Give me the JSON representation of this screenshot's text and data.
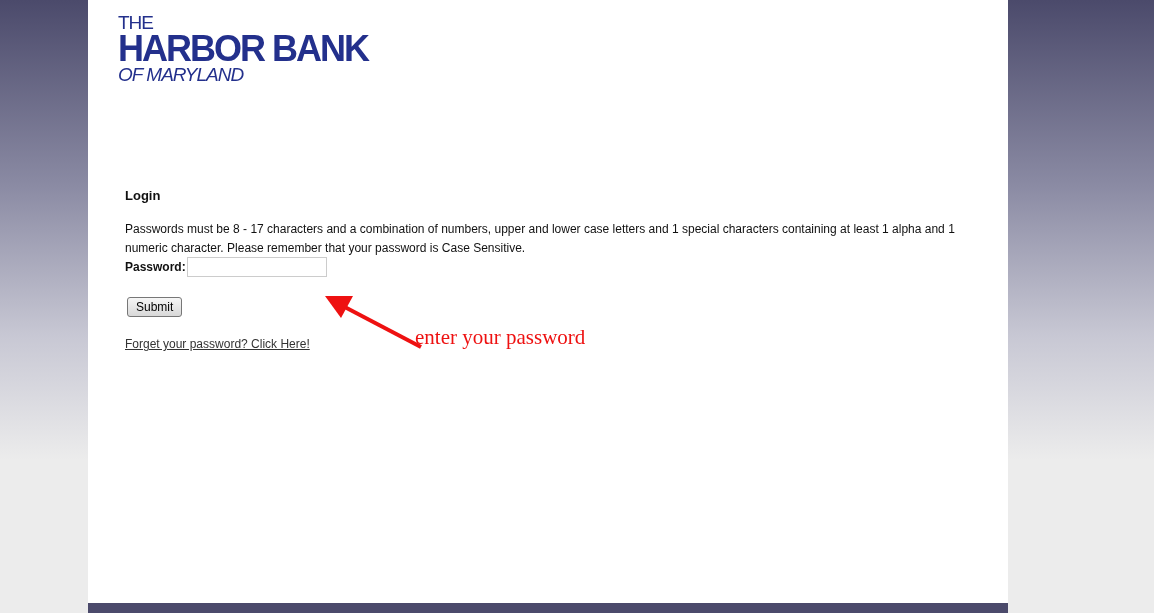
{
  "logo": {
    "line_1": "THE",
    "line_2": "HARBOR BANK",
    "line_3": "OF MARYLAND"
  },
  "login": {
    "title": "Login",
    "instructions": "Passwords must be 8 - 17 characters and a combination of numbers, upper and lower case letters and 1 special characters containing at least 1 alpha and 1 numeric character. Please remember that your password is Case Sensitive.",
    "password_label": "Password:",
    "submit": "Submit",
    "forgot_link": "Forget your password? Click Here!"
  },
  "annotation": {
    "text": "enter your password"
  }
}
